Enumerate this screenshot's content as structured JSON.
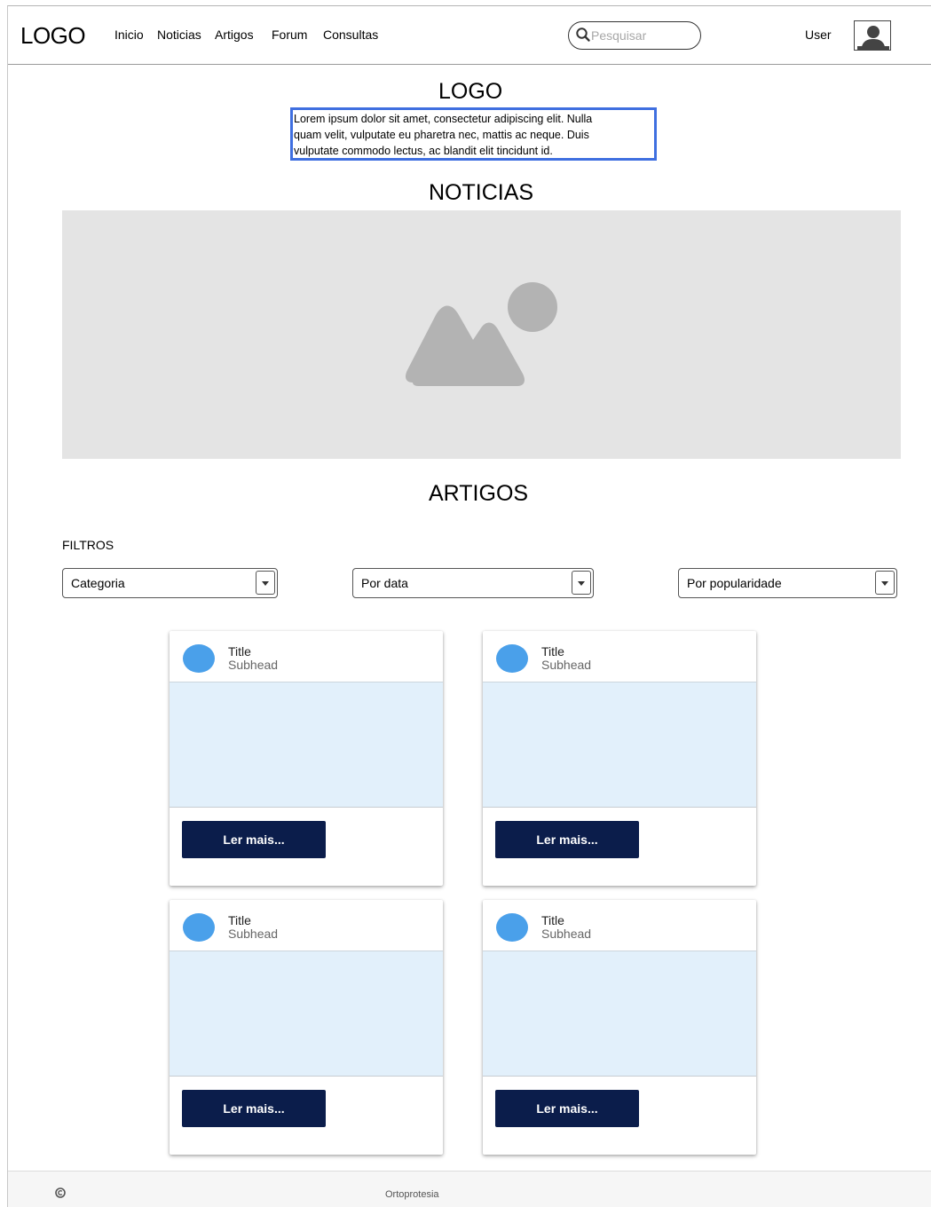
{
  "header": {
    "logo": "LOGO",
    "nav": [
      {
        "label": "Inicio"
      },
      {
        "label": "Noticias"
      },
      {
        "label": "Artigos"
      },
      {
        "label": "Forum"
      },
      {
        "label": "Consultas"
      }
    ],
    "search_placeholder": "Pesquisar",
    "user_label": "User"
  },
  "hero": {
    "logo": "LOGO",
    "text_lines": [
      "Lorem ipsum dolor sit amet, consectetur adipiscing elit. Nulla",
      "quam velit, vulputate eu pharetra nec, mattis ac neque. Duis",
      "vulputate commodo lectus, ac blandit elit tincidunt id."
    ]
  },
  "news": {
    "title": "NOTICIAS"
  },
  "articles": {
    "title": "ARTIGOS",
    "filters_label": "FILTROS",
    "filters": [
      {
        "value": "Categoria"
      },
      {
        "value": "Por data"
      },
      {
        "value": "Por popularidade"
      }
    ],
    "cards": [
      {
        "title": "Title",
        "subhead": "Subhead",
        "button": "Ler mais..."
      },
      {
        "title": "Title",
        "subhead": "Subhead",
        "button": "Ler mais..."
      },
      {
        "title": "Title",
        "subhead": "Subhead",
        "button": "Ler mais..."
      },
      {
        "title": "Title",
        "subhead": "Subhead",
        "button": "Ler mais..."
      }
    ]
  },
  "footer": {
    "text": "Ortoprotesia"
  },
  "colors": {
    "accent_border": "#3f6fe0",
    "button_bg": "#0b1d4b",
    "avatar_blue": "#4aa0ea",
    "card_media": "#e2f0fb",
    "placeholder_bg": "#e4e4e4"
  },
  "icons": [
    "search-icon",
    "user-avatar-icon",
    "image-placeholder-icon",
    "dropdown-arrow-icon",
    "copyright-icon"
  ]
}
